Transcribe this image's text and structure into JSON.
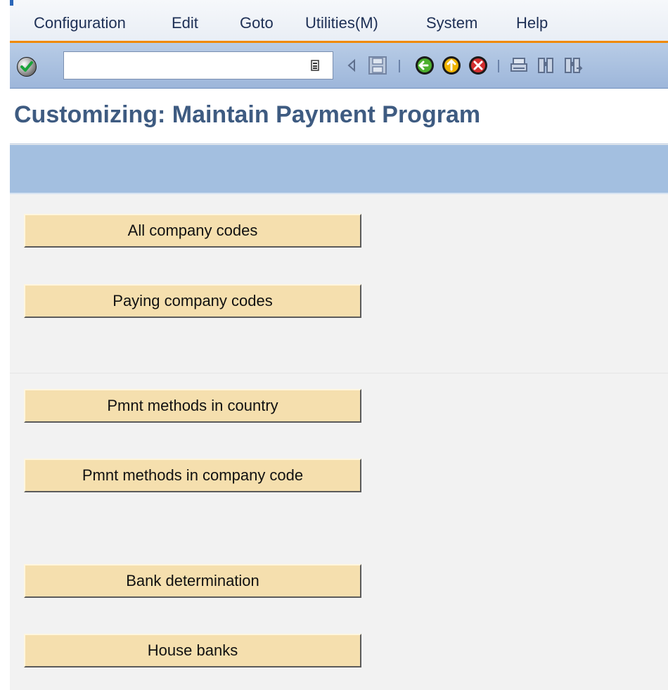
{
  "menubar": {
    "items": [
      {
        "label": "Configuration"
      },
      {
        "label": "Edit"
      },
      {
        "label": "Goto"
      },
      {
        "label": "Utilities(M)"
      },
      {
        "label": "System"
      },
      {
        "label": "Help"
      }
    ]
  },
  "toolbar": {
    "command_field_value": "",
    "icons": [
      "enter-icon",
      "command-dropdown-icon",
      "back-triangle-icon",
      "save-icon",
      "back-icon",
      "exit-icon",
      "cancel-icon",
      "print-icon",
      "find-icon",
      "find-next-icon"
    ]
  },
  "title": {
    "text": "Customizing: Maintain Payment Program"
  },
  "buttons": [
    {
      "label": "All company codes"
    },
    {
      "label": "Paying company codes"
    },
    {
      "label": "Pmnt methods in country"
    },
    {
      "label": "Pmnt methods in company code"
    },
    {
      "label": "Bank determination"
    },
    {
      "label": "House banks"
    }
  ],
  "colors": {
    "menu_accent": "#f08a00",
    "toolbar_blue": "#a3bfe0",
    "title_text": "#3e5b81",
    "button_fill": "#f5dfae"
  }
}
